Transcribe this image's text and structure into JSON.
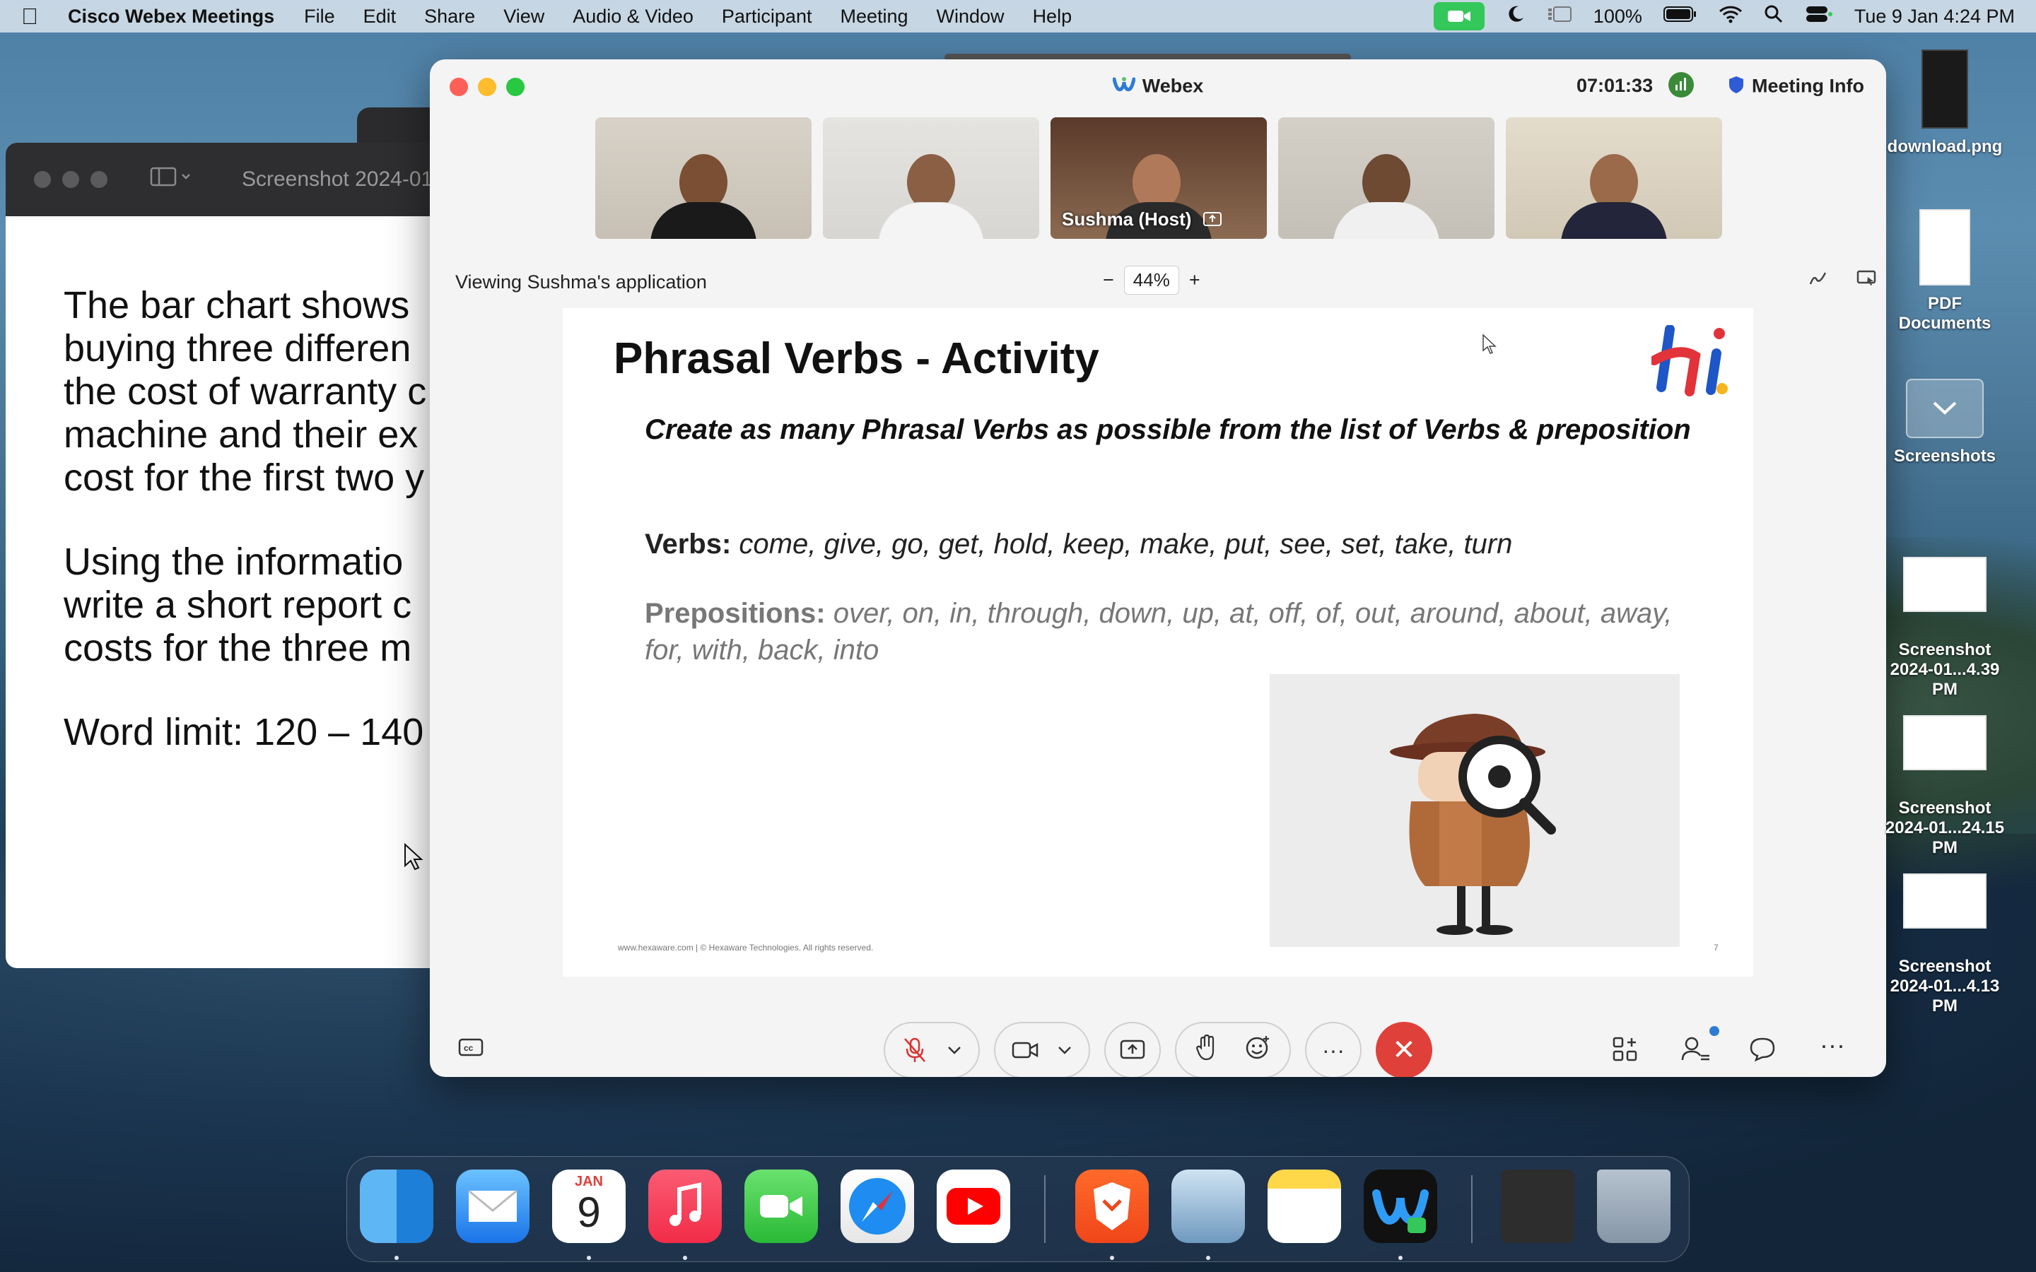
{
  "menubar": {
    "app_name": "Cisco Webex Meetings",
    "items": [
      "File",
      "Edit",
      "Share",
      "View",
      "Audio & Video",
      "Participant",
      "Meeting",
      "Window",
      "Help"
    ],
    "battery": "100%",
    "datetime": "Tue 9 Jan  4:24 PM"
  },
  "preview_window": {
    "title": "Screenshot 2024-01",
    "para1": [
      "The bar chart shows",
      "buying three differen",
      "the cost of warranty c",
      "machine and their ex",
      "cost for the first two y"
    ],
    "para2": [
      "Using the informatio",
      "write a short report c",
      "costs for the three m"
    ],
    "para3": "Word limit: 120 – 140"
  },
  "webex": {
    "title": "Webex",
    "timer": "07:01:33",
    "meeting_info": "Meeting Info",
    "host_label": "Sushma  (Host)",
    "viewing": "Viewing Sushma's application",
    "zoom": "44%",
    "zoom_minus": "−",
    "zoom_plus": "+"
  },
  "slide": {
    "title": "Phrasal Verbs - Activity",
    "subtitle": "Create as many Phrasal Verbs as possible from the list of Verbs & preposition",
    "verbs_label": "Verbs:",
    "verbs": "come, give, go, get, hold, keep, make, put, see, set, take, turn",
    "preps_label": "Prepositions:",
    "preps": "over, on, in, through, down, up, at, off, of, out, around, about, away, for, with, back, into",
    "footer": "www.hexaware.com  | © Hexaware Technologies. All rights reserved.",
    "page": "7",
    "logo_text": "hi"
  },
  "desktop": {
    "icons": [
      {
        "label": "download.png"
      },
      {
        "label": "PDF Documents"
      },
      {
        "label": "Screenshots"
      },
      {
        "label": "Screenshot\n2024-01...4.39 PM"
      },
      {
        "label": "Screenshot\n2024-01...24.15 PM"
      },
      {
        "label": "Screenshot\n2024-01...4.13 PM"
      }
    ]
  },
  "dock": {
    "calendar_month": "JAN",
    "calendar_day": "9"
  },
  "colors": {
    "accent": "#2e7bd6",
    "end_call": "#e0403a",
    "camera_active": "#34c759"
  }
}
